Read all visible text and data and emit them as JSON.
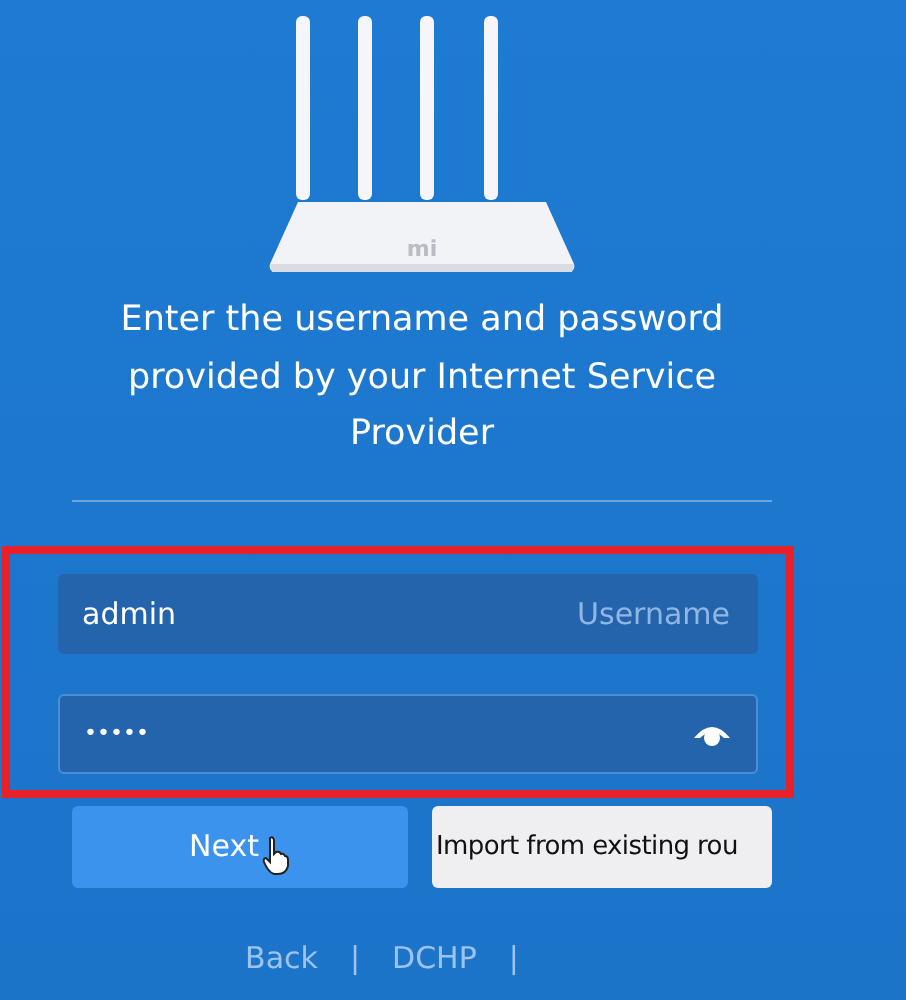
{
  "router_logo": "mi",
  "prompt": "Enter the username and password provided by your Internet Service Provider",
  "username_field": {
    "value": "admin",
    "placeholder": "Username"
  },
  "password_field": {
    "value": "•••••"
  },
  "highlighted": true,
  "buttons": [
    {
      "label": "Next",
      "kind": "primary"
    },
    {
      "label": "Import from existing rou",
      "kind": "secondary"
    }
  ],
  "footer_links": [
    "Back",
    "|",
    "DCHP",
    "|"
  ]
}
